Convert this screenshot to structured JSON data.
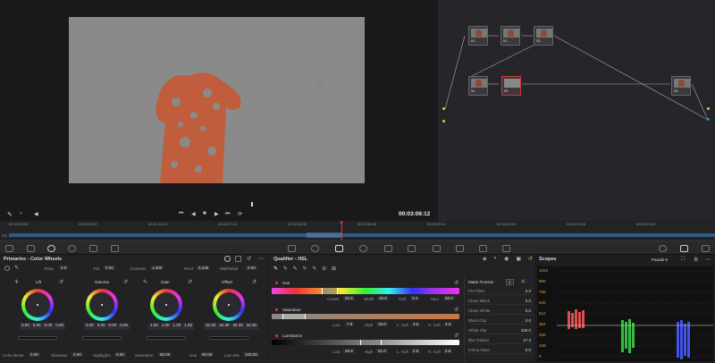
{
  "viewer": {
    "timecode": "00:03:06:12"
  },
  "timeline": {
    "track": "V1",
    "ticks": [
      "00:00:00:00",
      "00:00:09:07",
      "00:01:18:14",
      "00:01:27:21",
      "00:02:36:28",
      "00:03:46:00",
      "00:03:55:12",
      "00:04:04:19",
      "00:04:13:26",
      "00:05:23:03"
    ]
  },
  "nodes": [
    {
      "label": "01"
    },
    {
      "label": "02"
    },
    {
      "label": "03"
    },
    {
      "label": "04"
    },
    {
      "label": "05"
    },
    {
      "label": "06"
    }
  ],
  "primaries": {
    "title": "Primaries - Color Wheels",
    "temp_label": "Temp",
    "temp": "0.0",
    "tint_label": "Tint",
    "tint": "0.00",
    "contrast_label": "Contrast",
    "contrast": "1.000",
    "pivot_label": "Pivot",
    "pivot": "0.435",
    "middetail_label": "Mid/Detail",
    "middetail": "0.00",
    "wheels": [
      {
        "name": "Lift",
        "vals": [
          "0.00",
          "0.00",
          "0.00",
          "0.00"
        ]
      },
      {
        "name": "Gamma",
        "vals": [
          "0.00",
          "0.00",
          "0.00",
          "0.00"
        ]
      },
      {
        "name": "Gain",
        "vals": [
          "1.00",
          "1.00",
          "1.00",
          "1.00"
        ]
      },
      {
        "name": "Offset",
        "vals": [
          "32.30",
          "32.30",
          "32.30",
          "32.30"
        ]
      }
    ],
    "colorboost_label": "Color Boost",
    "colorboost": "0.00",
    "shadows_label": "Shadows",
    "shadows": "0.00",
    "highlights_label": "Highlights",
    "highlights": "0.00",
    "saturation_label": "Saturation",
    "saturation": "50.00",
    "hue_label": "Hue",
    "hue": "50.00",
    "lummix_label": "Lum Mix",
    "lummix": "100.00"
  },
  "qualifier": {
    "title": "Qualifier - HSL",
    "hue_label": "Hue",
    "center_label": "Center",
    "center": "32.5",
    "width_label": "Width",
    "width": "10.6",
    "soft_label": "Soft",
    "soft": "3.2",
    "sym_label": "Sym",
    "sym": "50.0",
    "sat_label": "Saturation",
    "lum_label": "Luminance",
    "sat_low_label": "Low",
    "sat_low": "7.8",
    "sat_high_label": "High",
    "sat_high": "18.6",
    "sat_lsoft_label": "L. Soft",
    "sat_lsoft": "3.6",
    "sat_hsoft_label": "H. Soft",
    "sat_hsoft": "3.3",
    "lum_low_label": "Low",
    "lum_low": "49.9",
    "lum_high_label": "High",
    "lum_high": "61.0",
    "lum_lsoft_label": "L. Soft",
    "lum_lsoft": "2.6",
    "lum_hsoft_label": "H. Soft",
    "lum_hsoft": "2.6",
    "matte_title": "Matte Finesse",
    "matte_tab1": "1",
    "matte_tab2": "2",
    "matte_rows": [
      {
        "label": "Pre-Filter",
        "value": "0.0"
      },
      {
        "label": "Clean Black",
        "value": "0.0"
      },
      {
        "label": "Clean White",
        "value": "0.0"
      },
      {
        "label": "Black Clip",
        "value": "0.0"
      },
      {
        "label": "White Clip",
        "value": "100.0"
      },
      {
        "label": "Blur Radius",
        "value": "17.3"
      },
      {
        "label": "In/Out Ratio",
        "value": "0.0"
      }
    ]
  },
  "scopes": {
    "title": "Scopes",
    "mode": "Parade",
    "scale": [
      "1023",
      "896",
      "768",
      "640",
      "512",
      "384",
      "256",
      "128",
      "0"
    ]
  }
}
